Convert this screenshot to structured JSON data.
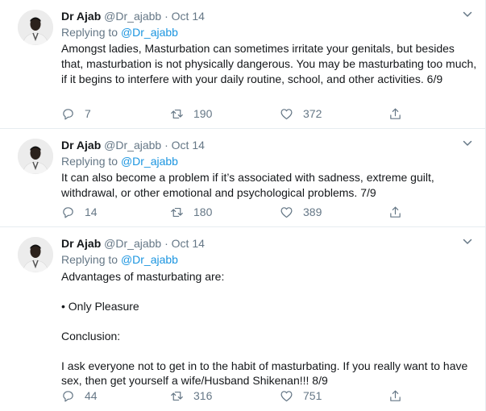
{
  "tweets": [
    {
      "name": "Dr Ajab",
      "handle": "@Dr_ajabb",
      "dot": "·",
      "date": "Oct 14",
      "replying_label": "Replying to",
      "replying_handle": "@Dr_ajabb",
      "paragraphs": [
        "Amongst ladies, Masturbation can sometimes irritate your genitals, but besides that, masturbation is not physically dangerous. You may be masturbating too much, if it begins to interfere with your daily routine, school, and other activities. 6/9"
      ],
      "replies": "7",
      "retweets": "190",
      "likes": "372"
    },
    {
      "name": "Dr Ajab",
      "handle": "@Dr_ajabb",
      "dot": "·",
      "date": "Oct 14",
      "replying_label": "Replying to",
      "replying_handle": "@Dr_ajabb",
      "paragraphs": [
        "It can also become a problem if it’s associated with sadness, extreme guilt, withdrawal, or other emotional and psychological problems. 7/9"
      ],
      "replies": "14",
      "retweets": "180",
      "likes": "389"
    },
    {
      "name": "Dr Ajab",
      "handle": "@Dr_ajabb",
      "dot": "·",
      "date": "Oct 14",
      "replying_label": "Replying to",
      "replying_handle": "@Dr_ajabb",
      "paragraphs": [
        "Advantages of masturbating are:",
        "• Only Pleasure",
        "Conclusion:",
        "I ask everyone not to get in to the habit of masturbating. If you really want to have sex, then get yourself a wife/Husband Shikenan!!!   8/9"
      ],
      "replies": "44",
      "retweets": "316",
      "likes": "751"
    }
  ],
  "icons": {
    "reply": "reply-icon",
    "retweet": "retweet-icon",
    "like": "heart-icon",
    "share": "share-icon",
    "more": "chevron-down-icon",
    "avatar": "avatar"
  },
  "colors": {
    "link": "#1b95e0",
    "muted": "#657786",
    "text": "#14171a",
    "border": "#e6ecf0"
  }
}
